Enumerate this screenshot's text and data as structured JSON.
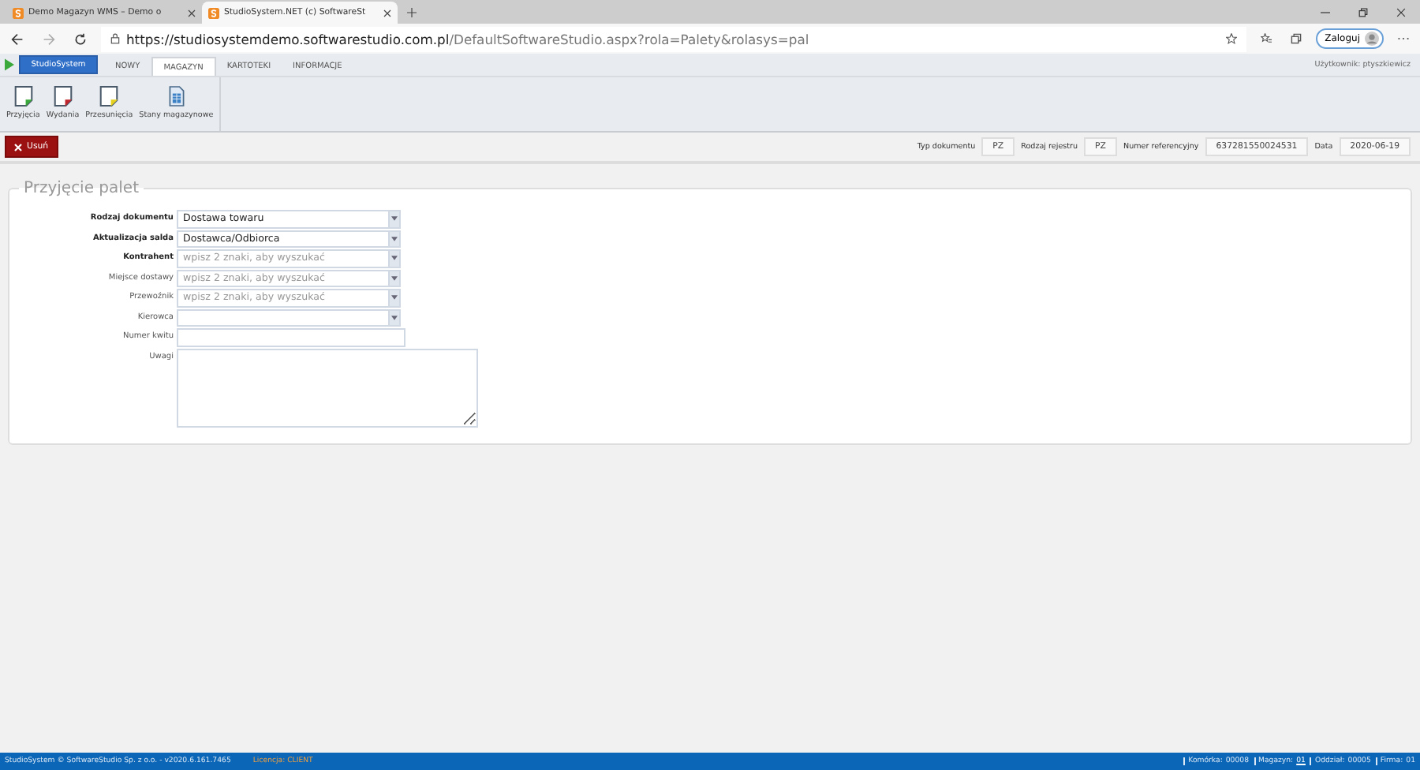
{
  "browser": {
    "tabs": [
      {
        "title": "Demo Magazyn WMS – Demo o",
        "selected": false
      },
      {
        "title": "StudioSystem.NET (c) SoftwareSt",
        "selected": true
      }
    ],
    "url": {
      "host": "https://studiosystemdemo.softwarestudio.com.pl",
      "path": "/DefaultSoftwareStudio.aspx?rola=Palety&rolasys=pal"
    },
    "profile_button": "Zaloguj"
  },
  "menu": {
    "brand": "StudioSystem",
    "tabs": [
      {
        "label": "NOWY",
        "selected": false
      },
      {
        "label": "MAGAZYN",
        "selected": true
      },
      {
        "label": "KARTOTEKI",
        "selected": false
      },
      {
        "label": "INFORMACJE",
        "selected": false
      }
    ],
    "user": "Użytkownik: ptyszkiewicz"
  },
  "ribbon": [
    {
      "label": "Przyjęcia",
      "kind": "doc",
      "color": "#3aa83a"
    },
    {
      "label": "Wydania",
      "kind": "doc",
      "color": "#c0262d"
    },
    {
      "label": "Przesunięcia",
      "kind": "doc",
      "color": "#e6d21e"
    },
    {
      "label": "Stany magazynowe",
      "kind": "sheet",
      "color": "#3b7fc4"
    }
  ],
  "delete_button": "Usuń",
  "doc_info": [
    {
      "label": "Typ dokumentu",
      "value": "PZ"
    },
    {
      "label": "Rodzaj rejestru",
      "value": "PZ"
    },
    {
      "label": "Numer referencyjny",
      "value": "637281550024531"
    },
    {
      "label": "Data",
      "value": "2020-06-19"
    }
  ],
  "form": {
    "title": "Przyjęcie palet",
    "fields": [
      {
        "label": "Rodzaj dokumentu",
        "bold": true,
        "kind": "select",
        "value": "Dostawa towaru"
      },
      {
        "label": "Aktualizacja salda",
        "bold": true,
        "kind": "select",
        "value": "Dostawca/Odbiorca"
      },
      {
        "label": "Kontrahent",
        "bold": true,
        "kind": "select",
        "placeholder": "wpisz 2 znaki, aby wyszukać"
      },
      {
        "label": "Miejsce dostawy",
        "bold": false,
        "kind": "select",
        "placeholder": "wpisz 2 znaki, aby wyszukać"
      },
      {
        "label": "Przewoźnik",
        "bold": false,
        "kind": "select",
        "placeholder": "wpisz 2 znaki, aby wyszukać"
      },
      {
        "label": "Kierowca",
        "bold": false,
        "kind": "select"
      },
      {
        "label": "Numer kwitu",
        "bold": false,
        "kind": "input"
      },
      {
        "label": "Uwagi",
        "bold": false,
        "kind": "textarea"
      }
    ]
  },
  "status": {
    "copyright": "StudioSystem © SoftwareStudio Sp. z o.o. - v2020.6.161.7465",
    "license": "Licencja: CLIENT",
    "items": [
      {
        "label": "Komórka:",
        "value": "00008",
        "link": false
      },
      {
        "label": "Magazyn:",
        "value": "01",
        "link": true
      },
      {
        "label": "Oddział:",
        "value": "00005",
        "link": false
      },
      {
        "label": "Firma:",
        "value": "01",
        "link": false
      }
    ]
  }
}
